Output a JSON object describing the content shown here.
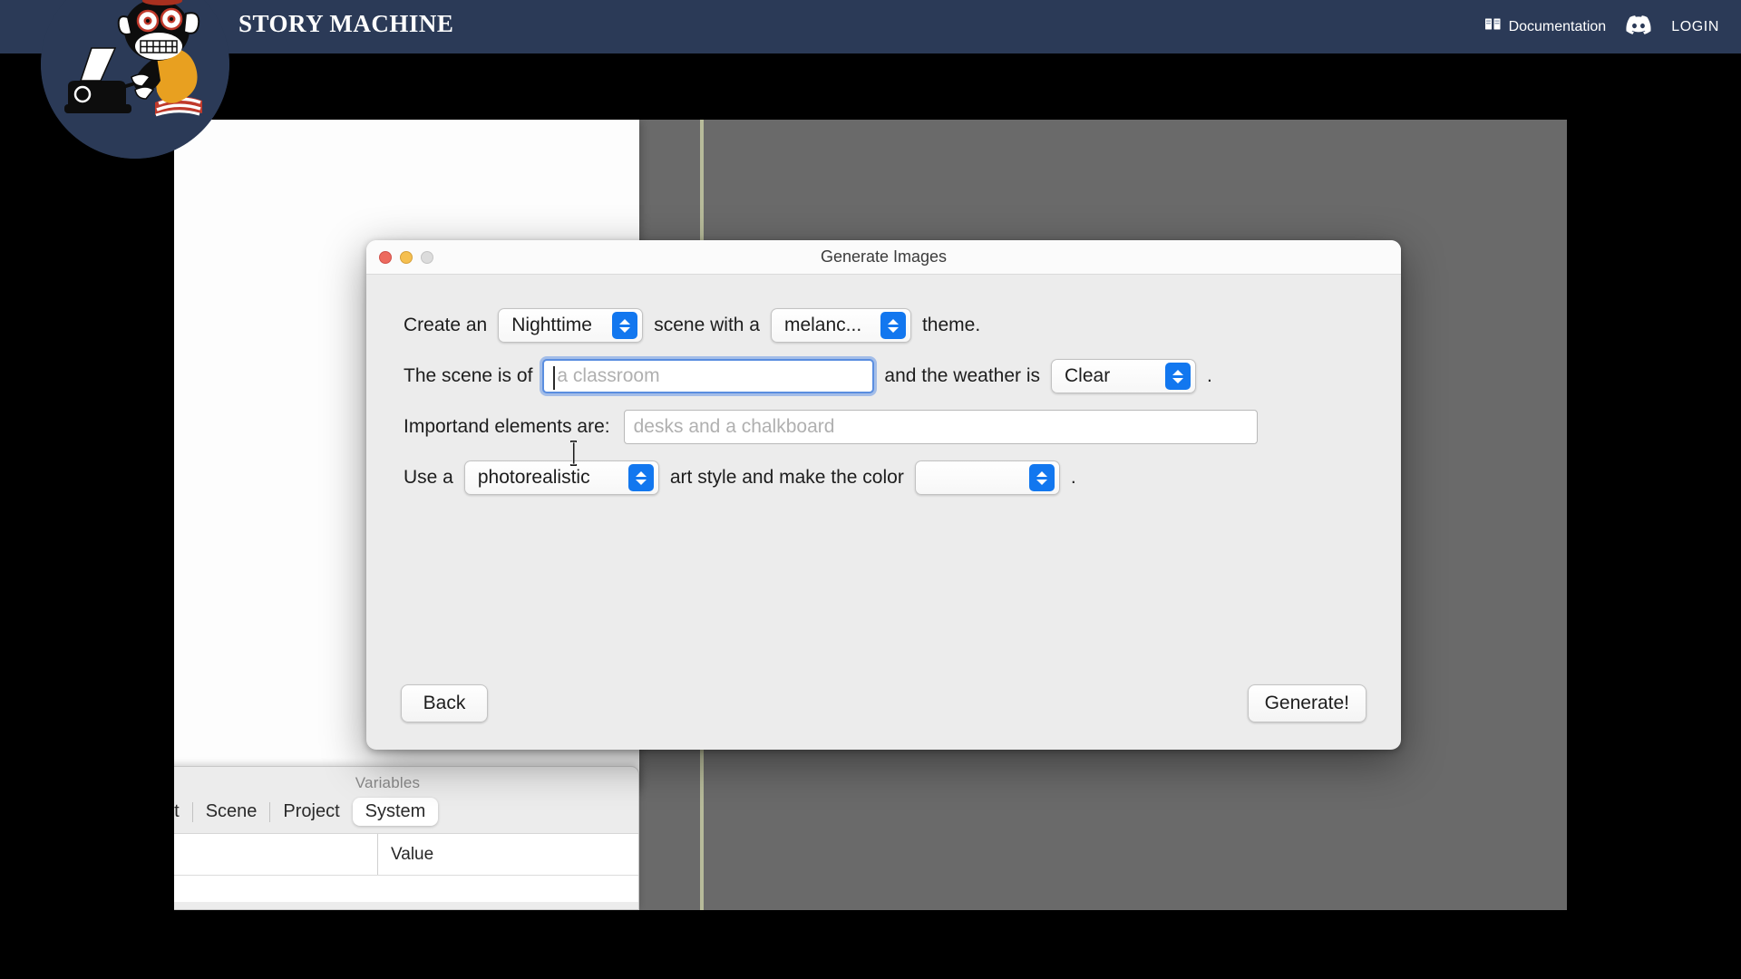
{
  "header": {
    "brand_title": "STORY MACHINE",
    "brand_color": "#2b3a57",
    "nav": {
      "documentation_label": "Documentation",
      "documentation_icon": "book-icon",
      "discord_icon": "discord-icon",
      "login_label": "LOGIN"
    }
  },
  "mascot": {
    "name": "monkey-typewriter-logo",
    "fez_color": "#c0392b",
    "shirt_color": "#e8a020",
    "badge_color": "#2b3a57"
  },
  "canvas": {
    "background_color": "#6a6a6a",
    "guide_line_color": "#b7bb9a",
    "panel_color": "#fdfdfd"
  },
  "variables_panel": {
    "title": "Variables",
    "tabs": [
      {
        "label": "ect",
        "selected": false
      },
      {
        "label": "Scene",
        "selected": false
      },
      {
        "label": "Project",
        "selected": false
      },
      {
        "label": "System",
        "selected": true
      }
    ],
    "columns": [
      "",
      "Value"
    ]
  },
  "dialog": {
    "title": "Generate Images",
    "traffic_lights": {
      "close": "#ed6a5e",
      "minimize": "#f5bf4f",
      "zoom": "#dcdcdc"
    },
    "rows": {
      "row1": {
        "prefix": "Create an",
        "time_of_day_value": "Nighttime",
        "middle": "scene with a",
        "theme_value": "melanc...",
        "suffix": "theme."
      },
      "row2": {
        "prefix": "The scene is of",
        "scene_placeholder": "a classroom",
        "scene_value": "",
        "middle": "and the weather is",
        "weather_value": "Clear",
        "suffix": "."
      },
      "row3": {
        "label": "Importand elements are:",
        "elements_placeholder": "desks and a chalkboard",
        "elements_value": ""
      },
      "row4": {
        "prefix": "Use a",
        "art_style_value": "photorealistic",
        "middle": "art style and make the color",
        "color_value": "",
        "suffix": "."
      }
    },
    "buttons": {
      "back_label": "Back",
      "generate_label": "Generate!"
    },
    "accent_color": "#1277ef",
    "focus_ring_color": "#5a8ee0"
  }
}
